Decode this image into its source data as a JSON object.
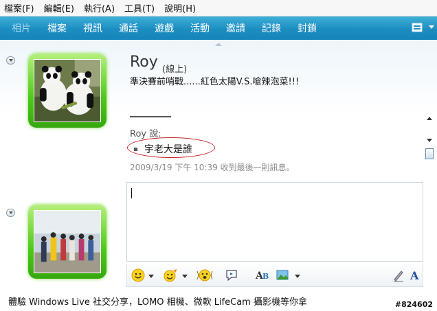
{
  "menu": [
    {
      "label": "檔案(F)"
    },
    {
      "label": "編輯(E)"
    },
    {
      "label": "執行(A)"
    },
    {
      "label": "工具(T)"
    },
    {
      "label": "說明(H)"
    }
  ],
  "toolbar": {
    "items": [
      "相片",
      "檔案",
      "視訊",
      "通話",
      "遊戲",
      "活動",
      "邀請",
      "記錄",
      "封鎖"
    ]
  },
  "contact": {
    "name": "Roy",
    "status": "(線上)",
    "personal_message": "準決賽前哨戰......紅色太陽V.S.嗆辣泡菜!!!"
  },
  "conversation": {
    "speaker": "Roy 說:",
    "message": "宇老大是誰",
    "last_received": "2009/3/19 下午 10:39 收到最後一則訊息。"
  },
  "footer": {
    "ad": "體驗 Windows Live 社交分享，LOMO 相機、微軟 LifeCam 攝影機等你拿",
    "image_id": "#824602"
  },
  "colors": {
    "toolbar_blue": "#1c8dc1",
    "avatar_green": "#4ec81c",
    "highlight_red": "#c8252a"
  }
}
